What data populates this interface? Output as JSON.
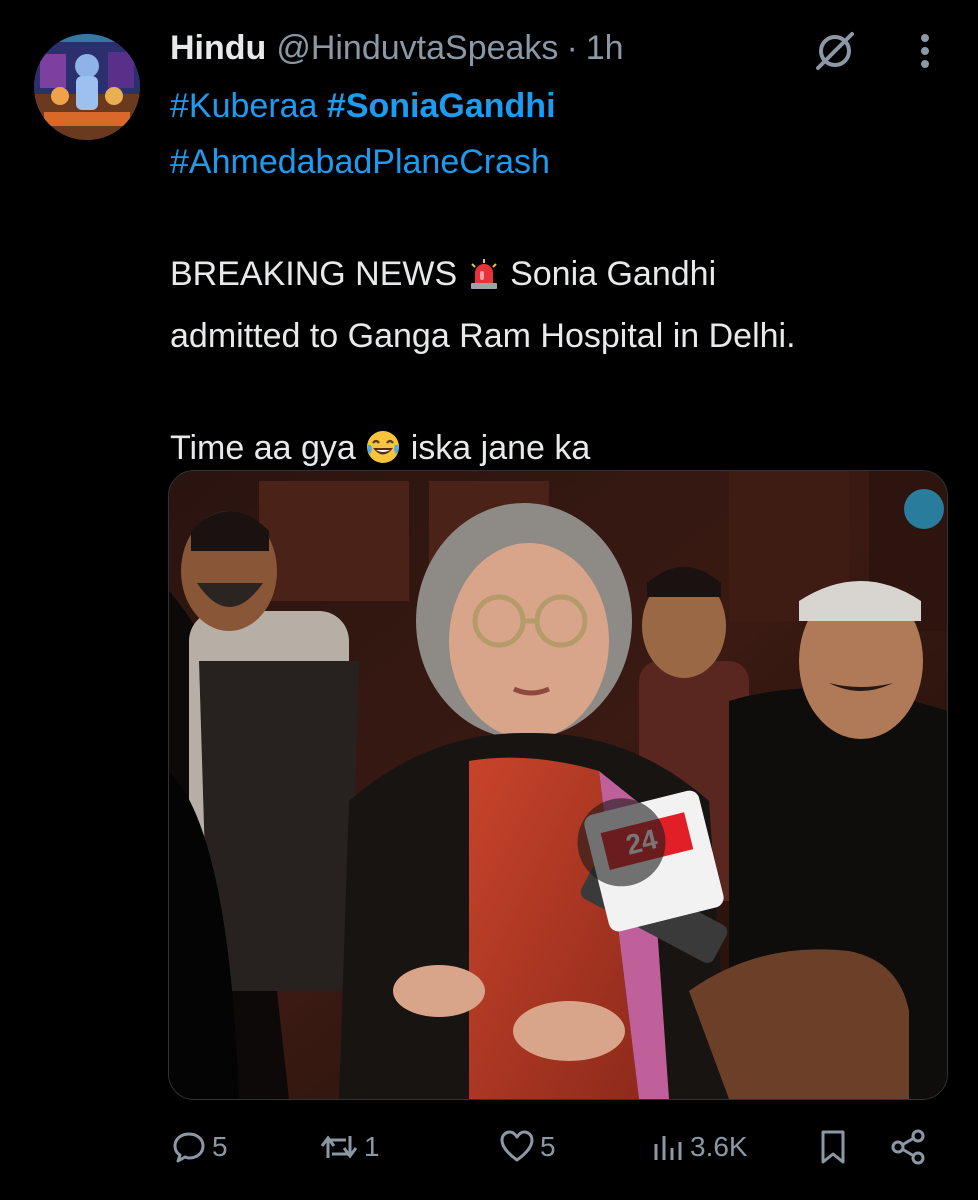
{
  "tweet": {
    "author": {
      "display_name": "Hindu",
      "handle": "@HinduvtaSpeaks",
      "separator": "·",
      "time": "1h"
    },
    "hashtags": {
      "kuberaa": "#Kuberaa",
      "sonia": "#SoniaGandhi",
      "crash": "#AhmedabadPlaneCrash"
    },
    "text": {
      "breaking": "BREAKING NEWS",
      "emoji_siren": "🚨",
      "line1_rest": "Sonia Gandhi",
      "line2": "admitted to Ganga Ram Hospital in Delhi.",
      "line3_start": "Time aa gya",
      "emoji_laugh": "😂",
      "line3_end": "iska jane ka"
    },
    "media": {
      "mic_logo": "24"
    },
    "actions": {
      "replies": "5",
      "reposts": "1",
      "likes": "5",
      "views": "3.6K"
    }
  },
  "icons": {
    "grok": "grok-icon",
    "more": "more-options-icon",
    "reply": "reply-icon",
    "repost": "repost-icon",
    "like": "like-icon",
    "views": "views-icon",
    "bookmark": "bookmark-icon",
    "share": "share-icon"
  },
  "colors": {
    "background": "#000000",
    "text": "#e7e9ea",
    "secondary": "#8b98a5",
    "link": "#1d9bf0"
  }
}
